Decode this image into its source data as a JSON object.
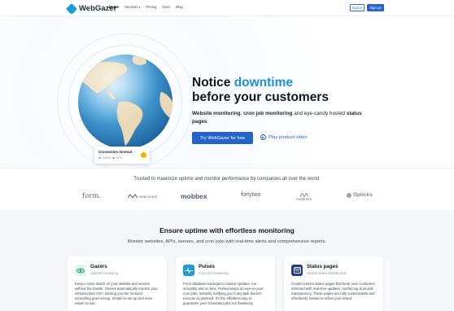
{
  "colors": {
    "accent": "#1d8fd8",
    "primary": "#2563c9",
    "alert": "#f0b000"
  },
  "nav": {
    "logo_text": "WebGazer",
    "links": [
      "Home",
      "Services",
      "Pricing",
      "Docs",
      "Blog"
    ],
    "services_caret": "▾",
    "signin": "Sign in",
    "signup": "Sign up"
  },
  "hero": {
    "headline_1": "Notice ",
    "headline_accent": "downtime",
    "headline_2": "before your customers",
    "lead_b1": "Website monitoring",
    "lead_t1": ", ",
    "lead_b2": "cron job monitoring",
    "lead_t2": " and eye-candy hosted ",
    "lead_b3": "status pages",
    "lead_t3": ".",
    "cta": "Try WebGazer for free",
    "play": "Play product video",
    "toast_title": "Connection timeout",
    "toast_meta": [
      "Noticed",
      "NOW"
    ]
  },
  "trusted": {
    "text": "Trusted to maximize uptime and monitor performance by companies all over the world.",
    "logos": [
      "form.",
      "wepcontrol",
      "mobbex",
      "fortytwo",
      "modmore",
      "Opticks"
    ]
  },
  "features": {
    "title": "Ensure uptime with effortless monitoring",
    "subtitle": "Monitor websites, APIs, servers, and cron jobs with real-time alerts and comprehensive reports.",
    "cards": [
      {
        "icon": "eye-icon",
        "name": "Gazers",
        "tag": "Uptime monitoring",
        "text": "Keep a close watch on your website and servers without the hassle. Gazers automatically monitor your infrastructure 24/7, alerting you the moment something goes wrong. Simple to set up and even easier to use."
      },
      {
        "icon": "pulse-icon",
        "name": "Pulses",
        "tag": "Cron job monitoring",
        "text": "From database backups to routine updates, run smoothly and on time. Pulses keeps an eye on your cron jobs, instantly notifying you if any task doesn't execute as planned. It's the effortless way to guarantee your scheduled jobs run flawlessly."
      },
      {
        "icon": "status-pages-icon",
        "name": "Status pages",
        "tag": "Hosted status dashboards",
        "text": "Create custom status pages that keep your customers informed with real-time updates, reinforcing trust and transparency. These pages are fully customizable and effortlessly hosted to reflect your brand."
      }
    ]
  }
}
